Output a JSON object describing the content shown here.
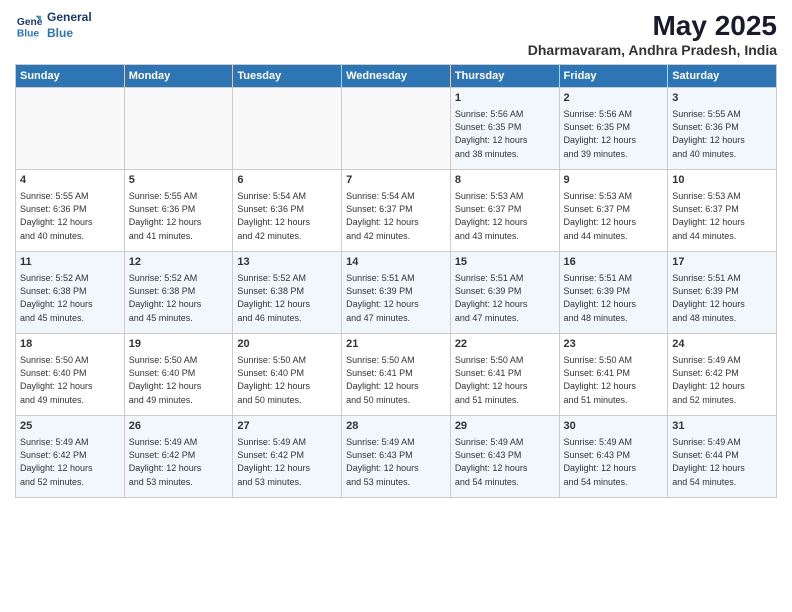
{
  "logo": {
    "line1": "General",
    "line2": "Blue"
  },
  "title": "May 2025",
  "subtitle": "Dharmavaram, Andhra Pradesh, India",
  "weekdays": [
    "Sunday",
    "Monday",
    "Tuesday",
    "Wednesday",
    "Thursday",
    "Friday",
    "Saturday"
  ],
  "weeks": [
    [
      {
        "day": "",
        "info": ""
      },
      {
        "day": "",
        "info": ""
      },
      {
        "day": "",
        "info": ""
      },
      {
        "day": "",
        "info": ""
      },
      {
        "day": "1",
        "info": "Sunrise: 5:56 AM\nSunset: 6:35 PM\nDaylight: 12 hours\nand 38 minutes."
      },
      {
        "day": "2",
        "info": "Sunrise: 5:56 AM\nSunset: 6:35 PM\nDaylight: 12 hours\nand 39 minutes."
      },
      {
        "day": "3",
        "info": "Sunrise: 5:55 AM\nSunset: 6:36 PM\nDaylight: 12 hours\nand 40 minutes."
      }
    ],
    [
      {
        "day": "4",
        "info": "Sunrise: 5:55 AM\nSunset: 6:36 PM\nDaylight: 12 hours\nand 40 minutes."
      },
      {
        "day": "5",
        "info": "Sunrise: 5:55 AM\nSunset: 6:36 PM\nDaylight: 12 hours\nand 41 minutes."
      },
      {
        "day": "6",
        "info": "Sunrise: 5:54 AM\nSunset: 6:36 PM\nDaylight: 12 hours\nand 42 minutes."
      },
      {
        "day": "7",
        "info": "Sunrise: 5:54 AM\nSunset: 6:37 PM\nDaylight: 12 hours\nand 42 minutes."
      },
      {
        "day": "8",
        "info": "Sunrise: 5:53 AM\nSunset: 6:37 PM\nDaylight: 12 hours\nand 43 minutes."
      },
      {
        "day": "9",
        "info": "Sunrise: 5:53 AM\nSunset: 6:37 PM\nDaylight: 12 hours\nand 44 minutes."
      },
      {
        "day": "10",
        "info": "Sunrise: 5:53 AM\nSunset: 6:37 PM\nDaylight: 12 hours\nand 44 minutes."
      }
    ],
    [
      {
        "day": "11",
        "info": "Sunrise: 5:52 AM\nSunset: 6:38 PM\nDaylight: 12 hours\nand 45 minutes."
      },
      {
        "day": "12",
        "info": "Sunrise: 5:52 AM\nSunset: 6:38 PM\nDaylight: 12 hours\nand 45 minutes."
      },
      {
        "day": "13",
        "info": "Sunrise: 5:52 AM\nSunset: 6:38 PM\nDaylight: 12 hours\nand 46 minutes."
      },
      {
        "day": "14",
        "info": "Sunrise: 5:51 AM\nSunset: 6:39 PM\nDaylight: 12 hours\nand 47 minutes."
      },
      {
        "day": "15",
        "info": "Sunrise: 5:51 AM\nSunset: 6:39 PM\nDaylight: 12 hours\nand 47 minutes."
      },
      {
        "day": "16",
        "info": "Sunrise: 5:51 AM\nSunset: 6:39 PM\nDaylight: 12 hours\nand 48 minutes."
      },
      {
        "day": "17",
        "info": "Sunrise: 5:51 AM\nSunset: 6:39 PM\nDaylight: 12 hours\nand 48 minutes."
      }
    ],
    [
      {
        "day": "18",
        "info": "Sunrise: 5:50 AM\nSunset: 6:40 PM\nDaylight: 12 hours\nand 49 minutes."
      },
      {
        "day": "19",
        "info": "Sunrise: 5:50 AM\nSunset: 6:40 PM\nDaylight: 12 hours\nand 49 minutes."
      },
      {
        "day": "20",
        "info": "Sunrise: 5:50 AM\nSunset: 6:40 PM\nDaylight: 12 hours\nand 50 minutes."
      },
      {
        "day": "21",
        "info": "Sunrise: 5:50 AM\nSunset: 6:41 PM\nDaylight: 12 hours\nand 50 minutes."
      },
      {
        "day": "22",
        "info": "Sunrise: 5:50 AM\nSunset: 6:41 PM\nDaylight: 12 hours\nand 51 minutes."
      },
      {
        "day": "23",
        "info": "Sunrise: 5:50 AM\nSunset: 6:41 PM\nDaylight: 12 hours\nand 51 minutes."
      },
      {
        "day": "24",
        "info": "Sunrise: 5:49 AM\nSunset: 6:42 PM\nDaylight: 12 hours\nand 52 minutes."
      }
    ],
    [
      {
        "day": "25",
        "info": "Sunrise: 5:49 AM\nSunset: 6:42 PM\nDaylight: 12 hours\nand 52 minutes."
      },
      {
        "day": "26",
        "info": "Sunrise: 5:49 AM\nSunset: 6:42 PM\nDaylight: 12 hours\nand 53 minutes."
      },
      {
        "day": "27",
        "info": "Sunrise: 5:49 AM\nSunset: 6:42 PM\nDaylight: 12 hours\nand 53 minutes."
      },
      {
        "day": "28",
        "info": "Sunrise: 5:49 AM\nSunset: 6:43 PM\nDaylight: 12 hours\nand 53 minutes."
      },
      {
        "day": "29",
        "info": "Sunrise: 5:49 AM\nSunset: 6:43 PM\nDaylight: 12 hours\nand 54 minutes."
      },
      {
        "day": "30",
        "info": "Sunrise: 5:49 AM\nSunset: 6:43 PM\nDaylight: 12 hours\nand 54 minutes."
      },
      {
        "day": "31",
        "info": "Sunrise: 5:49 AM\nSunset: 6:44 PM\nDaylight: 12 hours\nand 54 minutes."
      }
    ]
  ]
}
